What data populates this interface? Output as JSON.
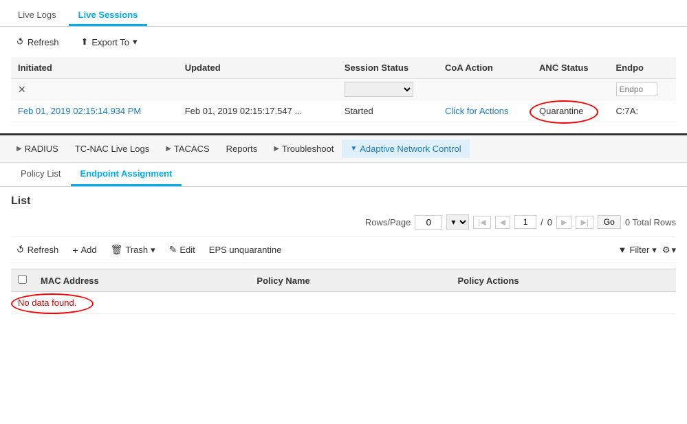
{
  "topTabs": {
    "tabs": [
      {
        "label": "Live Logs",
        "active": false
      },
      {
        "label": "Live Sessions",
        "active": true
      }
    ]
  },
  "section1": {
    "toolbar": {
      "refreshLabel": "Refresh",
      "exportLabel": "Export To"
    },
    "table": {
      "columns": [
        "Initiated",
        "Updated",
        "Session Status",
        "CoA Action",
        "ANC Status",
        "Endpo"
      ],
      "filterRow": {
        "sessionStatusPlaceholder": "",
        "endpointPlaceholder": "Endpo"
      },
      "rows": [
        {
          "initiated": "Feb 01, 2019 02:15:14.934 PM",
          "updated": "Feb 01, 2019 02:15:17.547 ...",
          "sessionStatus": "Started",
          "coaAction": "Click for Actions",
          "ancStatus": "Quarantine",
          "endpoint": "C:7A:"
        }
      ]
    }
  },
  "section2": {
    "navBar": {
      "items": [
        {
          "label": "RADIUS",
          "hasArrow": true,
          "active": false
        },
        {
          "label": "TC-NAC Live Logs",
          "hasArrow": false,
          "active": false
        },
        {
          "label": "TACACS",
          "hasArrow": true,
          "active": false
        },
        {
          "label": "Reports",
          "hasArrow": false,
          "active": false
        },
        {
          "label": "Troubleshoot",
          "hasArrow": true,
          "active": false
        },
        {
          "label": "Adaptive Network Control",
          "hasArrow": false,
          "isDropdown": true,
          "active": true
        }
      ]
    },
    "subTabs": [
      {
        "label": "Policy List",
        "active": false
      },
      {
        "label": "Endpoint Assignment",
        "active": true
      }
    ],
    "listTitle": "List",
    "listControls": {
      "rowsPerPageLabel": "Rows/Page",
      "rowsValue": "0",
      "pageValue": "1",
      "totalPages": "0",
      "goLabel": "Go",
      "totalRowsLabel": "0 Total Rows"
    },
    "listToolbar": {
      "refreshLabel": "Refresh",
      "addLabel": "Add",
      "trashLabel": "Trash",
      "editLabel": "Edit",
      "epsLabel": "EPS unquarantine",
      "filterLabel": "Filter",
      "gearLabel": "⚙"
    },
    "table": {
      "columns": [
        "",
        "MAC Address",
        "Policy Name",
        "Policy Actions"
      ],
      "noDataText": "No data found."
    }
  }
}
